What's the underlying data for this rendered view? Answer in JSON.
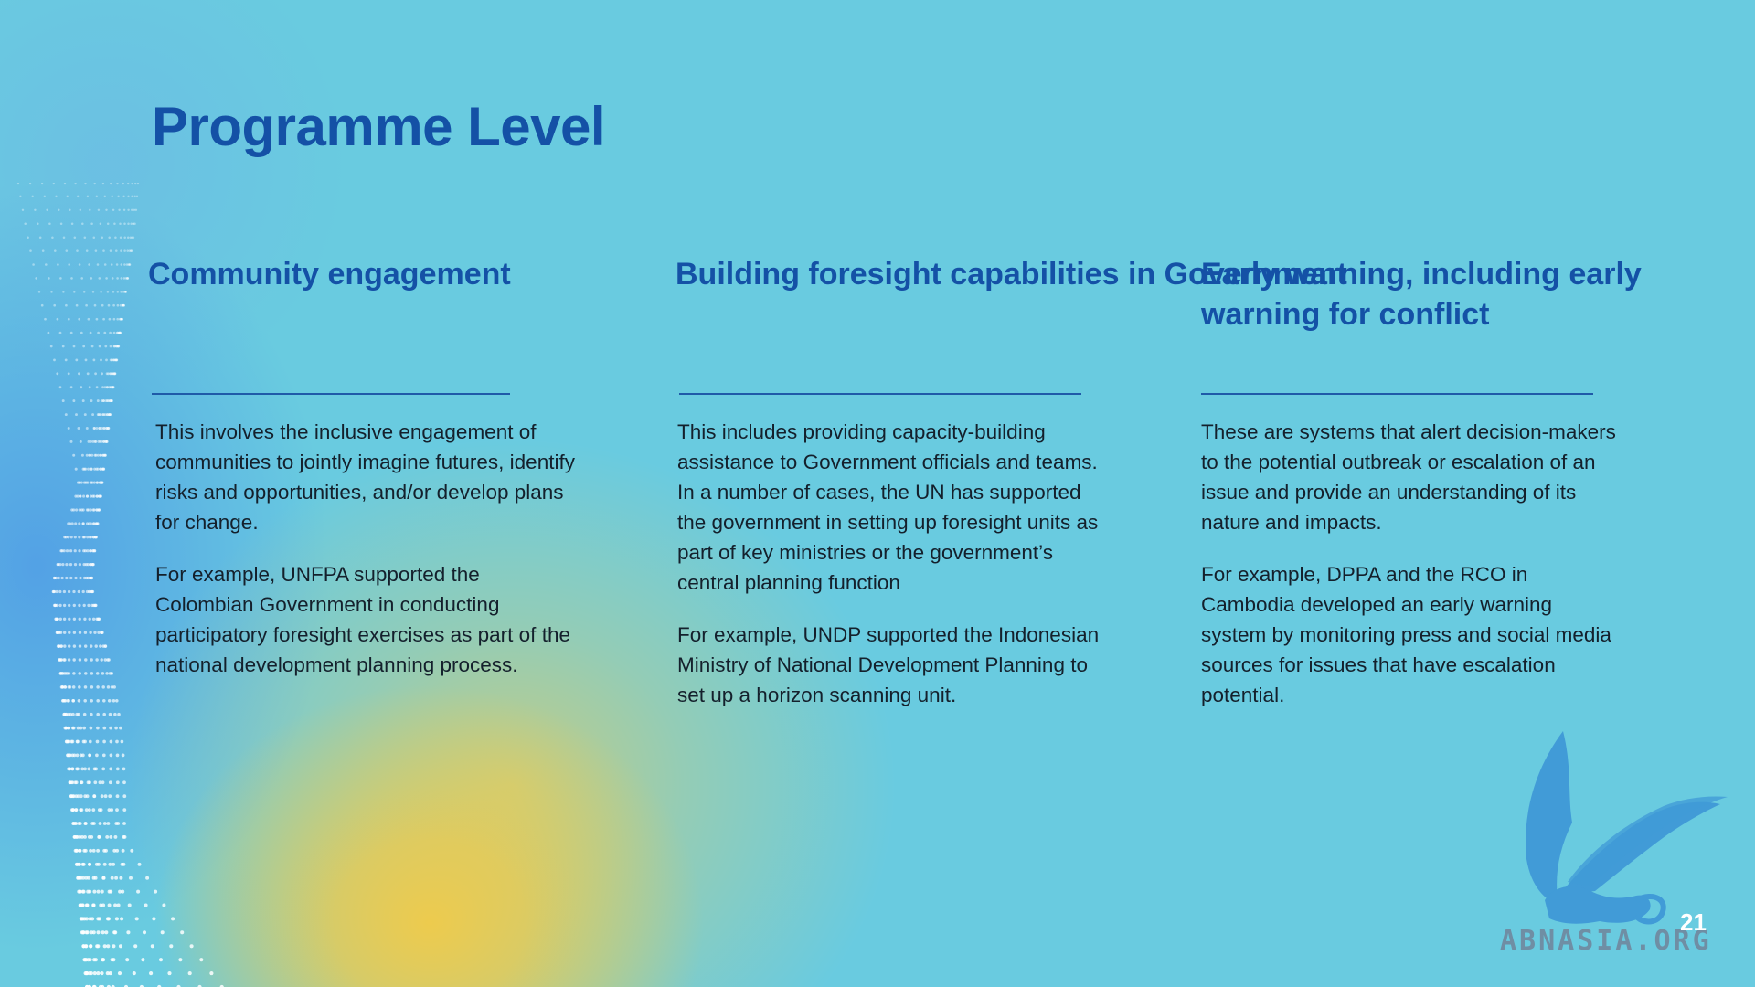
{
  "slide": {
    "title": "Programme Level",
    "page_number": "21"
  },
  "columns": [
    {
      "heading": "Community engagement",
      "paragraphs": [
        "This involves the inclusive engagement of communities to jointly imagine futures, identify risks and opportunities, and/or develop plans for change.",
        "For example, UNFPA supported the Colombian Government in conducting participatory foresight exercises as part of the national development planning process."
      ]
    },
    {
      "heading": "Building foresight capabilities in Government",
      "paragraphs": [
        "This includes providing capacity-building assistance to Government officials and teams. In a number of cases, the UN has supported the government in setting up foresight units as part of key ministries or the government’s central planning function",
        "For example, UNDP supported the Indonesian Ministry of National Development Planning to set up a horizon scanning unit."
      ]
    },
    {
      "heading": "Early warning, including early warning for conflict",
      "paragraphs": [
        "These are systems that alert decision-makers to the potential outbreak or escalation of an issue and provide an understanding of its nature and impacts.",
        "For example, DPPA and the RCO in Cambodia developed an early warning system by monitoring press and social media sources for issues that have escalation potential."
      ]
    }
  ],
  "watermark": {
    "text": "ABNASIA.ORG",
    "icon": "griffin-logo-icon",
    "color": "#2f8fcf"
  },
  "colors": {
    "background": "#69cbe0",
    "heading": "#1451a6",
    "body_text": "#14202c",
    "accent_yellow": "#f2cb48",
    "accent_blue": "#4f9ae6"
  }
}
